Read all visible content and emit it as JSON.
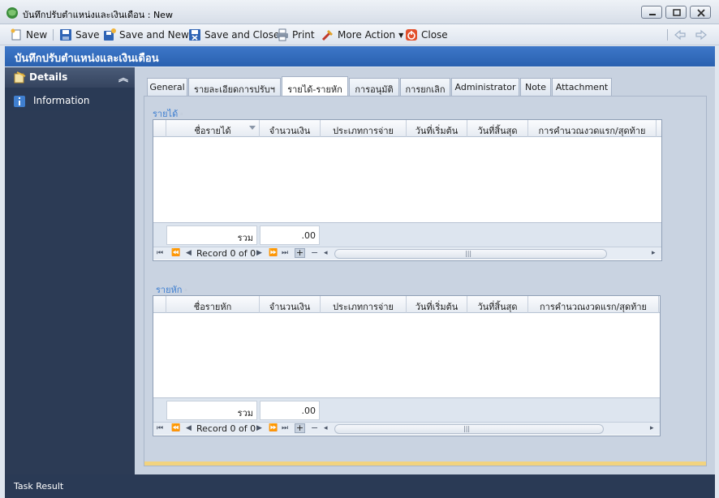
{
  "window": {
    "title": "บันทึกปรับตำแหน่งและเงินเดือน : New"
  },
  "toolbar": {
    "new_label": "New",
    "save_label": "Save",
    "save_and_new_label": "Save and New",
    "save_and_close_label": "Save and Close",
    "print_label": "Print",
    "more_action_label": "More Action",
    "close_label": "Close"
  },
  "header": {
    "title": "บันทึกปรับตำแหน่งและเงินเดือน"
  },
  "sidebar": {
    "group_label": "Details",
    "items": [
      {
        "label": "Information"
      }
    ]
  },
  "tabs": [
    {
      "label": "General"
    },
    {
      "label": "รายละเอียดการปรับฯ"
    },
    {
      "label": "รายได้-รายหัก",
      "active": true
    },
    {
      "label": "การอนุมัติ"
    },
    {
      "label": "การยกเลิก"
    },
    {
      "label": "Administrator"
    },
    {
      "label": "Note"
    },
    {
      "label": "Attachment"
    }
  ],
  "income_grid": {
    "group_label": "รายได้",
    "columns": [
      "ชื่อรายได้",
      "จำนวนเงิน",
      "ประเภทการจ่าย",
      "วันที่เริ่มต้น",
      "วันที่สิ้นสุด",
      "การคำนวณงวดแรก/สุดท้าย"
    ],
    "total_label": "รวม",
    "total_value": ".00",
    "record_text": "Record 0 of 0"
  },
  "deduction_grid": {
    "group_label": "รายหัก",
    "columns": [
      "ชื่อรายหัก",
      "จำนวนเงิน",
      "ประเภทการจ่าย",
      "วันที่เริ่มต้น",
      "วันที่สิ้นสุด",
      "การคำนวณงวดแรก/สุดท้าย"
    ],
    "total_label": "รวม",
    "total_value": ".00",
    "record_text": "Record 0 of 0"
  },
  "footer": {
    "task_result_label": "Task Result"
  },
  "colors": {
    "header_blue": "#2f68b8",
    "nav_dark": "#2c3b55",
    "accent_gold": "#f2d37e"
  }
}
